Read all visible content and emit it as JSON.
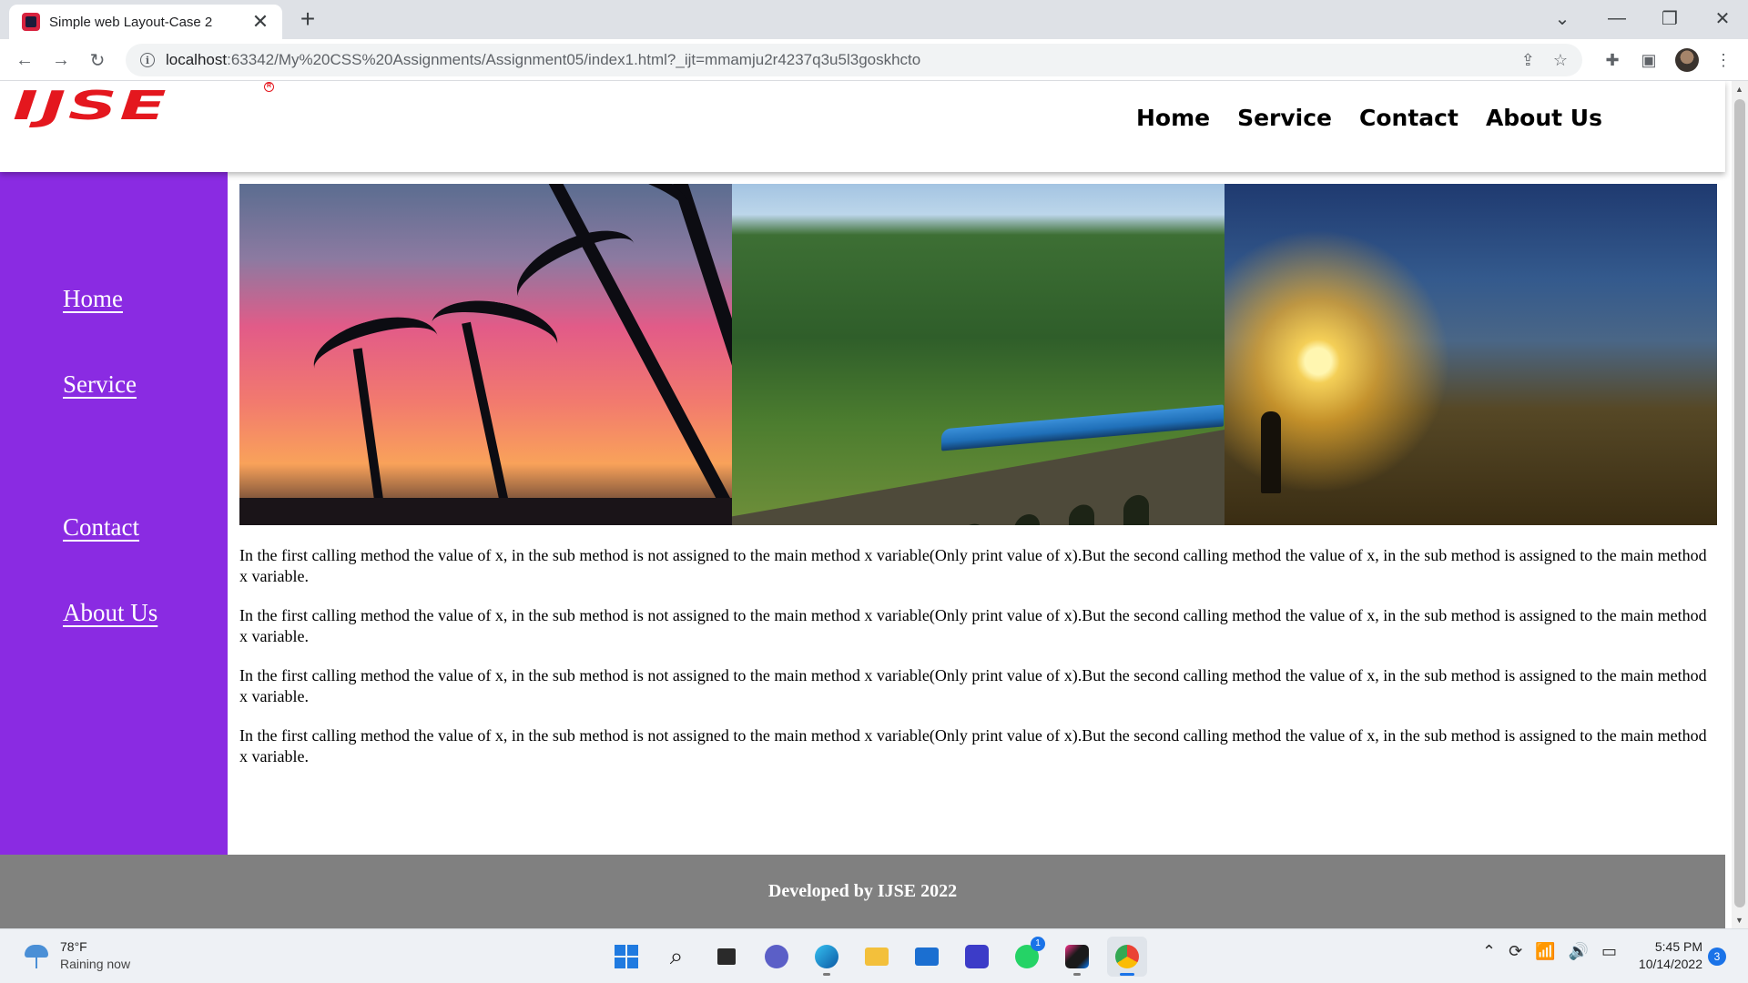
{
  "browser": {
    "tab_title": "Simple web Layout-Case 2",
    "tab_close_glyph": "✕",
    "new_tab_glyph": "+",
    "url_host": "localhost",
    "url_path": ":63342/My%20CSS%20Assignments/Assignment05/index1.html?_ijt=mmamju2r4237q3u5l3goskhcto",
    "window_controls": [
      "chevron-down-icon",
      "minimize-icon",
      "restore-icon",
      "close-icon"
    ],
    "toolbar_icons": [
      "share-icon",
      "star-icon",
      "extensions-icon",
      "side-panel-icon",
      "avatar",
      "menu-icon"
    ]
  },
  "site": {
    "logo_text": "IJSE",
    "logo_registered": "R",
    "brand_color": "#e4171e",
    "sidebar_color": "#8a2be2",
    "footer_color": "#808080",
    "top_nav": [
      "Home",
      "Service",
      "Contact",
      "About Us"
    ],
    "side_nav": [
      "Home",
      "Service",
      "Contact",
      "About Us"
    ],
    "banner_images": [
      "palm-trees-sunset",
      "train-on-bridge",
      "sunset-hills"
    ],
    "paragraphs": [
      "In the first calling method the value of x, in the sub method is not assigned to the main method x variable(Only print value of x).But the second calling method the value of x, in the sub method is assigned to the main method x variable.",
      "In the first calling method the value of x, in the sub method is not assigned to the main method x variable(Only print value of x).But the second calling method the value of x, in the sub method is assigned to the main method x variable.",
      "In the first calling method the value of x, in the sub method is not assigned to the main method x variable(Only print value of x).But the second calling method the value of x, in the sub method is assigned to the main method x variable.",
      "In the first calling method the value of x, in the sub method is not assigned to the main method x variable(Only print value of x).But the second calling method the value of x, in the sub method is assigned to the main method x variable."
    ],
    "footer_text": "Developed by IJSE 2022"
  },
  "taskbar": {
    "weather_temp": "78°F",
    "weather_desc": "Raining now",
    "apps": [
      "start",
      "search",
      "task-view",
      "meet",
      "edge",
      "file-explorer",
      "mail",
      "visual-studio",
      "whatsapp",
      "intellij",
      "chrome"
    ],
    "whatsapp_badge": "1",
    "time": "5:45 PM",
    "date": "10/14/2022",
    "notification_count": "3"
  }
}
